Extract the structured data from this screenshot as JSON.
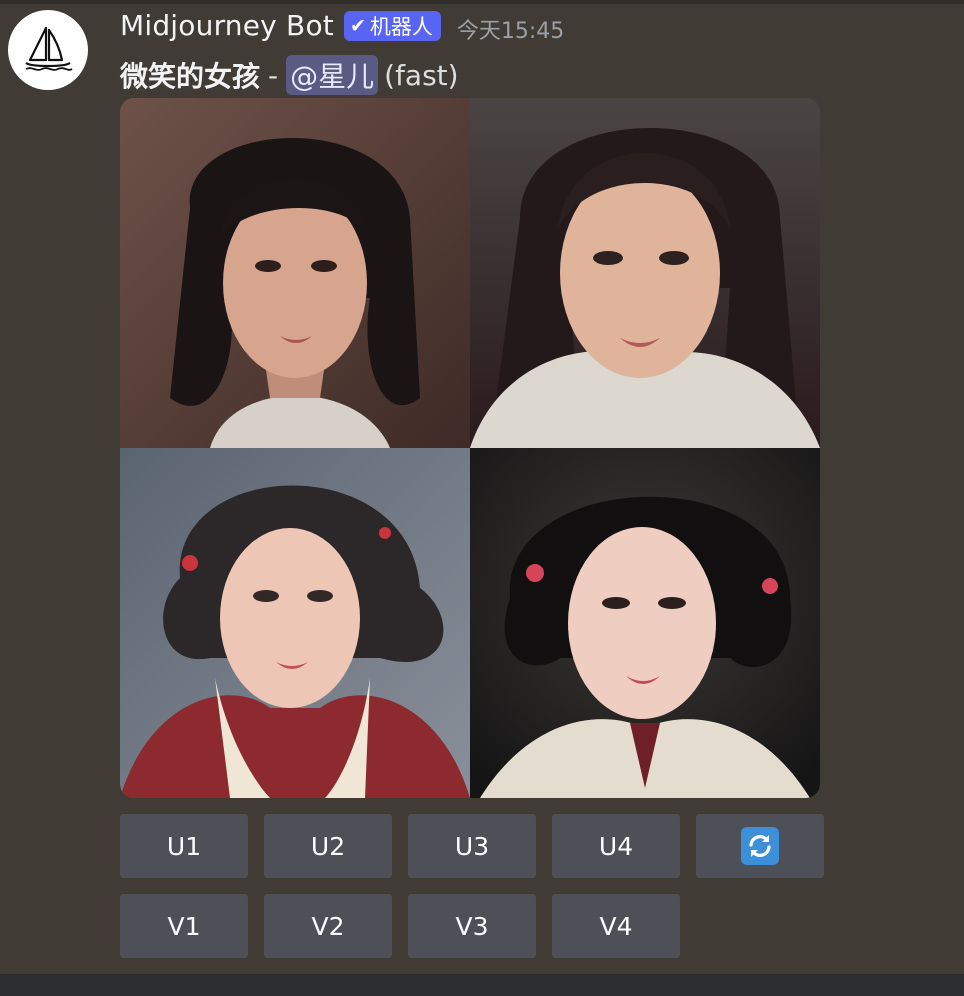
{
  "message": {
    "author": "Midjourney Bot",
    "badge_label": "机器人",
    "timestamp": "今天15:45",
    "prompt": "微笑的女孩",
    "separator": "-",
    "mention": "@星儿",
    "speed": "(fast)"
  },
  "buttons": {
    "upscale": [
      "U1",
      "U2",
      "U3",
      "U4"
    ],
    "variation": [
      "V1",
      "V2",
      "V3",
      "V4"
    ],
    "reroll_icon": "refresh-icon"
  },
  "colors": {
    "background": "#403c35",
    "button": "#4e5058",
    "badge": "#5865f2",
    "mention": "#5a5a82",
    "reroll": "#3c8fd8"
  }
}
